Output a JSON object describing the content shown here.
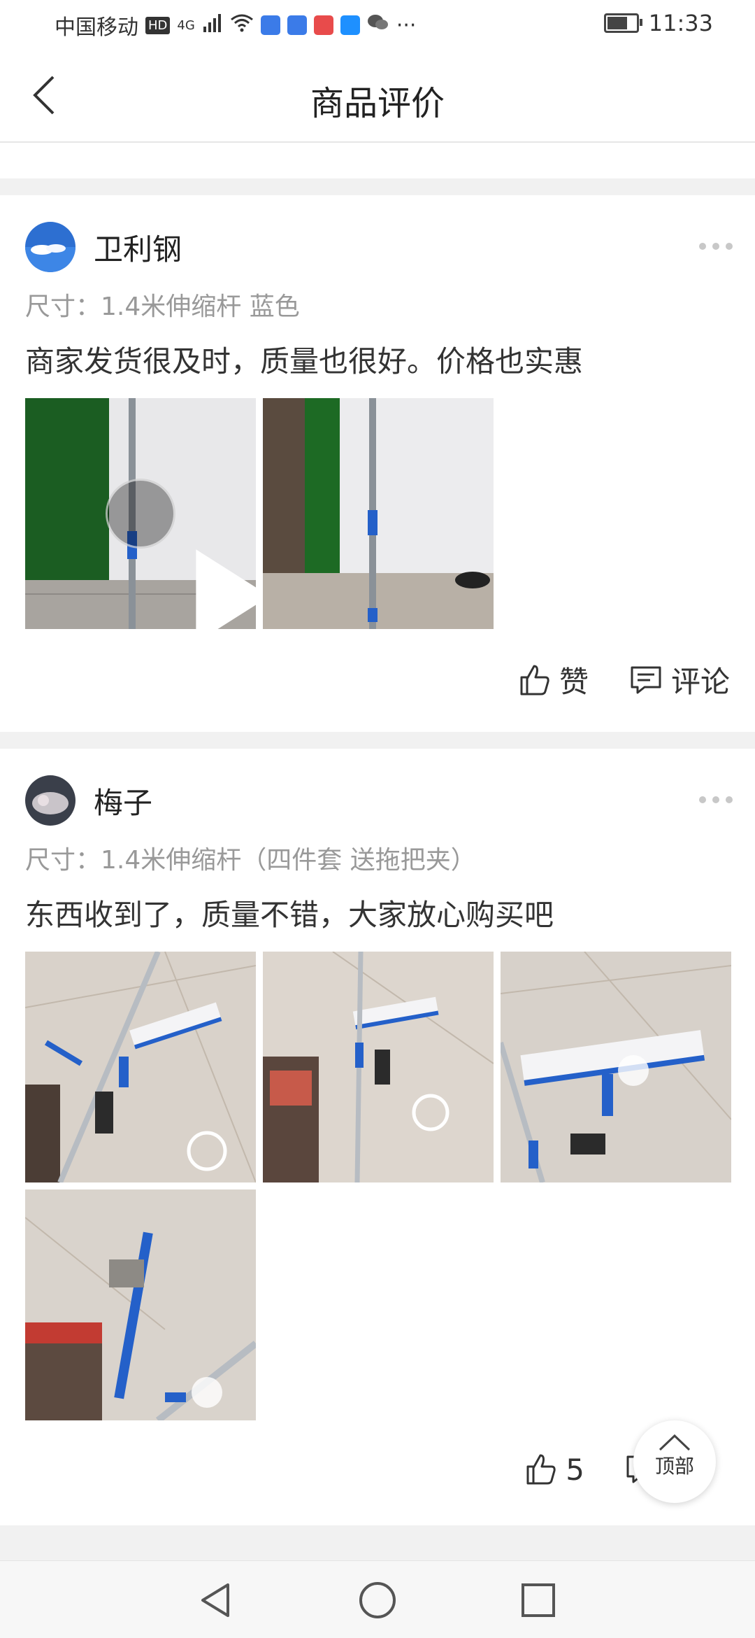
{
  "status_bar": {
    "carrier": "中国移动",
    "hd": "HD",
    "network": "4G",
    "more": "···",
    "time": "11:33"
  },
  "header": {
    "title": "商品评价"
  },
  "reviews": [
    {
      "username": "卫利钢",
      "spec": "尺寸：1.4米伸缩杆  蓝色",
      "content": "商家发货很及时，质量也很好。价格也实惠",
      "like_label": "赞",
      "comment_label": "评论"
    },
    {
      "username": "梅子",
      "spec": "尺寸：1.4米伸缩杆（四件套  送拖把夹）",
      "content": "东西收到了，质量不错，大家放心购买吧",
      "like_count": "5"
    }
  ],
  "back_to_top": {
    "label": "顶部"
  },
  "colors": {
    "accent_blue": "#1f6fd6",
    "text_primary": "#222222",
    "text_secondary": "#999999",
    "divider": "#f1f1f1"
  }
}
